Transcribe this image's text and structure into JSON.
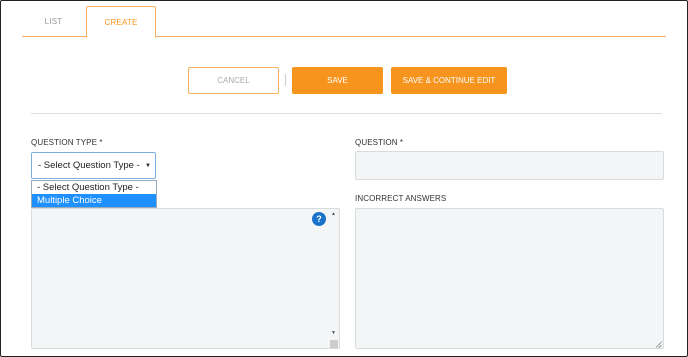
{
  "tabs": [
    {
      "label": "LIST"
    },
    {
      "label": "CREATE"
    }
  ],
  "actions": {
    "cancel": "CANCEL",
    "save": "SAVE",
    "save_continue": "SAVE & CONTINUE EDIT"
  },
  "form": {
    "question_type_label": "QUESTION TYPE *",
    "question_type_selected": "- Select Question Type -",
    "question_type_options": [
      "- Select Question Type -",
      "Multiple Choice"
    ],
    "question_label": "QUESTION *",
    "incorrect_answers_label": "INCORRECT ANSWERS",
    "help_symbol": "?"
  },
  "colors": {
    "accent": "#f7941d",
    "highlight": "#1e90ff",
    "help": "#1a73c9"
  }
}
